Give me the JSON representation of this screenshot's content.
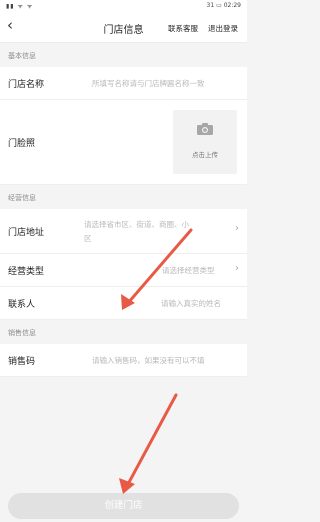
{
  "status_bar": {
    "signal": "▮▮ ᯤ ᯤ",
    "battery_percent": "31",
    "time": "02:29"
  },
  "header": {
    "title": "门店信息",
    "service_link": "联系客服",
    "logout_link": "退出登录"
  },
  "sections": {
    "basic": "基本信息",
    "business": "经营信息",
    "sales": "销售信息"
  },
  "fields": {
    "store_name": {
      "label": "门店名称",
      "placeholder": "所填写名称请与门店牌匾名称一致"
    },
    "store_photo": {
      "label": "门脸照",
      "upload_label": "点击上传"
    },
    "address": {
      "label": "门店地址",
      "placeholder_line1": "请选择省市区、街道、商圈、小",
      "placeholder_line2": "区"
    },
    "business_type": {
      "label": "经营类型",
      "placeholder": "请选择经营类型"
    },
    "contact": {
      "label": "联系人",
      "placeholder": "请输入真实的姓名"
    },
    "sales_code": {
      "label": "销售码",
      "placeholder": "请输入销售码，如果没有可以不填"
    }
  },
  "actions": {
    "create_label": "创建门店"
  },
  "colors": {
    "arrow": "#e85a45",
    "button_disabled": "#e1e1e1",
    "background": "#f4f4f4"
  }
}
